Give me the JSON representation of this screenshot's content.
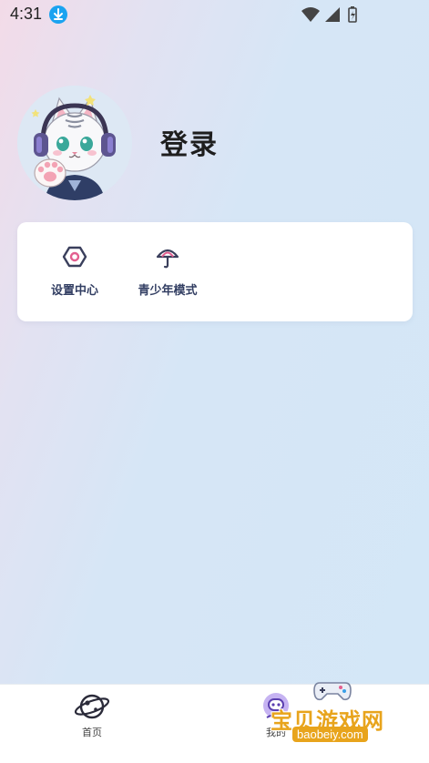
{
  "status_bar": {
    "time": "4:31",
    "icons": [
      "download-icon",
      "wifi-icon",
      "signal-icon",
      "battery-icon"
    ]
  },
  "profile": {
    "login_label": "登录",
    "avatar": "cat-avatar-with-headphones"
  },
  "menu": {
    "items": [
      {
        "label": "设置中心",
        "icon": "settings-hexagon-icon"
      },
      {
        "label": "青少年模式",
        "icon": "umbrella-icon"
      }
    ]
  },
  "tab_bar": {
    "tabs": [
      {
        "label": "首页",
        "icon": "planet-icon",
        "active": false
      },
      {
        "label": "我的",
        "icon": "astronaut-icon",
        "active": true
      }
    ]
  },
  "watermark": {
    "text": "宝贝游戏网",
    "url": "baobeiy.com"
  },
  "colors": {
    "menu_text": "#333f63",
    "accent": "#1aa3f0",
    "watermark": "#e8a41c"
  }
}
